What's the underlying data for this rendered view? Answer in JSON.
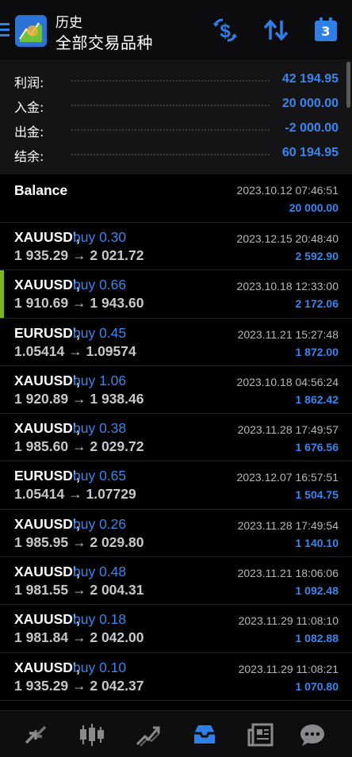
{
  "header": {
    "title_small": "历史",
    "title_large": "全部交易品种",
    "calendar_day": "3"
  },
  "summary": {
    "profit_label": "利润:",
    "profit_value": "42 194.95",
    "deposit_label": "入金:",
    "deposit_value": "20 000.00",
    "withdraw_label": "出金:",
    "withdraw_value": "-2 000.00",
    "balance_label": "结余:",
    "balance_value": "60 194.95"
  },
  "balance_row": {
    "label": "Balance",
    "time": "2023.10.12 07:46:51",
    "amount": "20 000.00"
  },
  "deals": [
    {
      "symbol": "XAUUSD',",
      "side": "buy 0.30",
      "prices": "1 935.29 → 2 021.72",
      "time": "2023.12.15 20:48:40",
      "profit": "2 592.90"
    },
    {
      "symbol": "XAUUSD',",
      "side": "buy 0.66",
      "prices": "1 910.69 → 1 943.60",
      "time": "2023.10.18 12:33:00",
      "profit": "2 172.06"
    },
    {
      "symbol": "EURUSD',",
      "side": "buy 0.45",
      "prices": "1.05414 → 1.09574",
      "time": "2023.11.21 15:27:48",
      "profit": "1 872.00"
    },
    {
      "symbol": "XAUUSD',",
      "side": "buy 1.06",
      "prices": "1 920.89 → 1 938.46",
      "time": "2023.10.18 04:56:24",
      "profit": "1 862.42"
    },
    {
      "symbol": "XAUUSD',",
      "side": "buy 0.38",
      "prices": "1 985.60 → 2 029.72",
      "time": "2023.11.28 17:49:57",
      "profit": "1 676.56"
    },
    {
      "symbol": "EURUSD',",
      "side": "buy 0.65",
      "prices": "1.05414 → 1.07729",
      "time": "2023.12.07 16:57:51",
      "profit": "1 504.75"
    },
    {
      "symbol": "XAUUSD',",
      "side": "buy 0.26",
      "prices": "1 985.95 → 2 029.80",
      "time": "2023.11.28 17:49:54",
      "profit": "1 140.10"
    },
    {
      "symbol": "XAUUSD',",
      "side": "buy 0.48",
      "prices": "1 981.55 → 2 004.31",
      "time": "2023.11.21 18:06:06",
      "profit": "1 092.48"
    },
    {
      "symbol": "XAUUSD',",
      "side": "buy 0.18",
      "prices": "1 981.84 → 2 042.00",
      "time": "2023.11.29 11:08:10",
      "profit": "1 082.88"
    },
    {
      "symbol": "XAUUSD',",
      "side": "buy 0.10",
      "prices": "1 935.29 → 2 042.37",
      "time": "2023.11.29 11:08:21",
      "profit": "1 070.80"
    }
  ],
  "bottom_nav": [
    {
      "icon": "quotes-icon"
    },
    {
      "icon": "chart-icon"
    },
    {
      "icon": "trade-icon"
    },
    {
      "icon": "history-icon",
      "active": true
    },
    {
      "icon": "news-icon"
    },
    {
      "icon": "chat-icon"
    }
  ],
  "colors": {
    "accent": "#3a86ef",
    "selected_marker": "#7bb81c",
    "icon_gray": "#8a8a8e"
  }
}
